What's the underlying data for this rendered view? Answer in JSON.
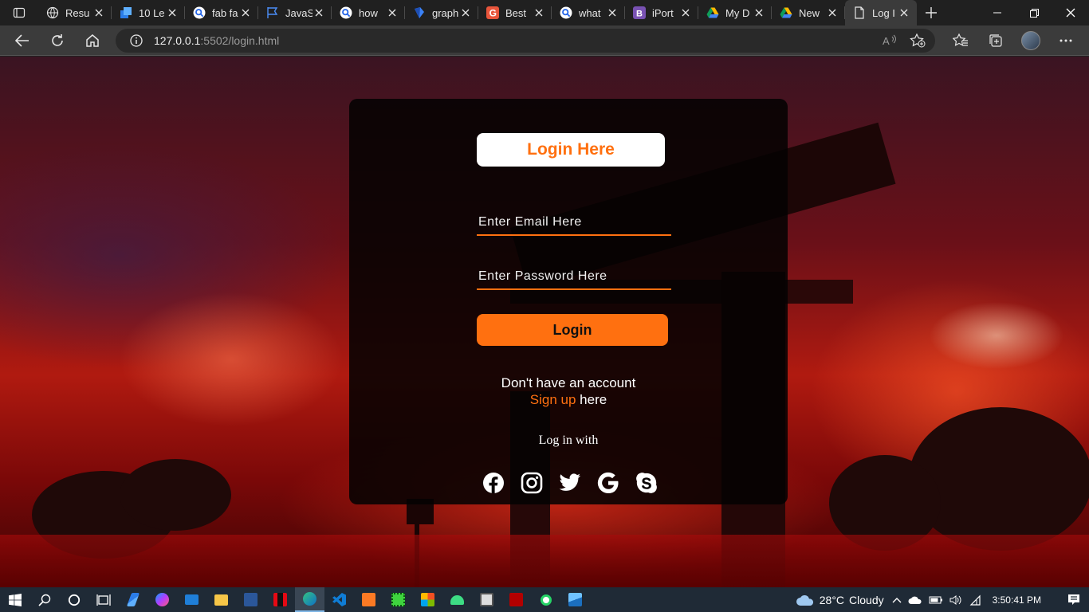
{
  "browser": {
    "tabs": [
      {
        "title": "Resu",
        "icon": "globe-icon"
      },
      {
        "title": "10 Le",
        "icon": "cube-icon"
      },
      {
        "title": "fab fa",
        "icon": "search-icon"
      },
      {
        "title": "JavaS",
        "icon": "flag-icon"
      },
      {
        "title": "how",
        "icon": "search-icon"
      },
      {
        "title": "graph",
        "icon": "graph-icon"
      },
      {
        "title": "Best",
        "icon": "g-logo-icon"
      },
      {
        "title": "what",
        "icon": "search-icon"
      },
      {
        "title": "iPort",
        "icon": "bootstrap-icon"
      },
      {
        "title": "My D",
        "icon": "drive-icon"
      },
      {
        "title": "New",
        "icon": "drive-icon"
      },
      {
        "title": "Log I",
        "icon": "page-icon",
        "active": true
      }
    ],
    "url_host": "127.0.0.1",
    "url_rest": ":5502/login.html"
  },
  "login": {
    "heading": "Login Here",
    "email_placeholder": "Enter Email Here",
    "password_placeholder": "Enter Password Here",
    "submit": "Login",
    "no_account": "Don't have an account",
    "signup_link": "Sign up",
    "signup_suffix": " here",
    "login_with": "Log in with",
    "socials": [
      "facebook-icon",
      "instagram-icon",
      "twitter-icon",
      "google-icon",
      "skype-icon"
    ]
  },
  "taskbar": {
    "weather_temp": "28°C",
    "weather_desc": "Cloudy",
    "time": "3:50:41 PM"
  },
  "colors": {
    "accent": "#ff7010",
    "card_bg": "#040202"
  }
}
